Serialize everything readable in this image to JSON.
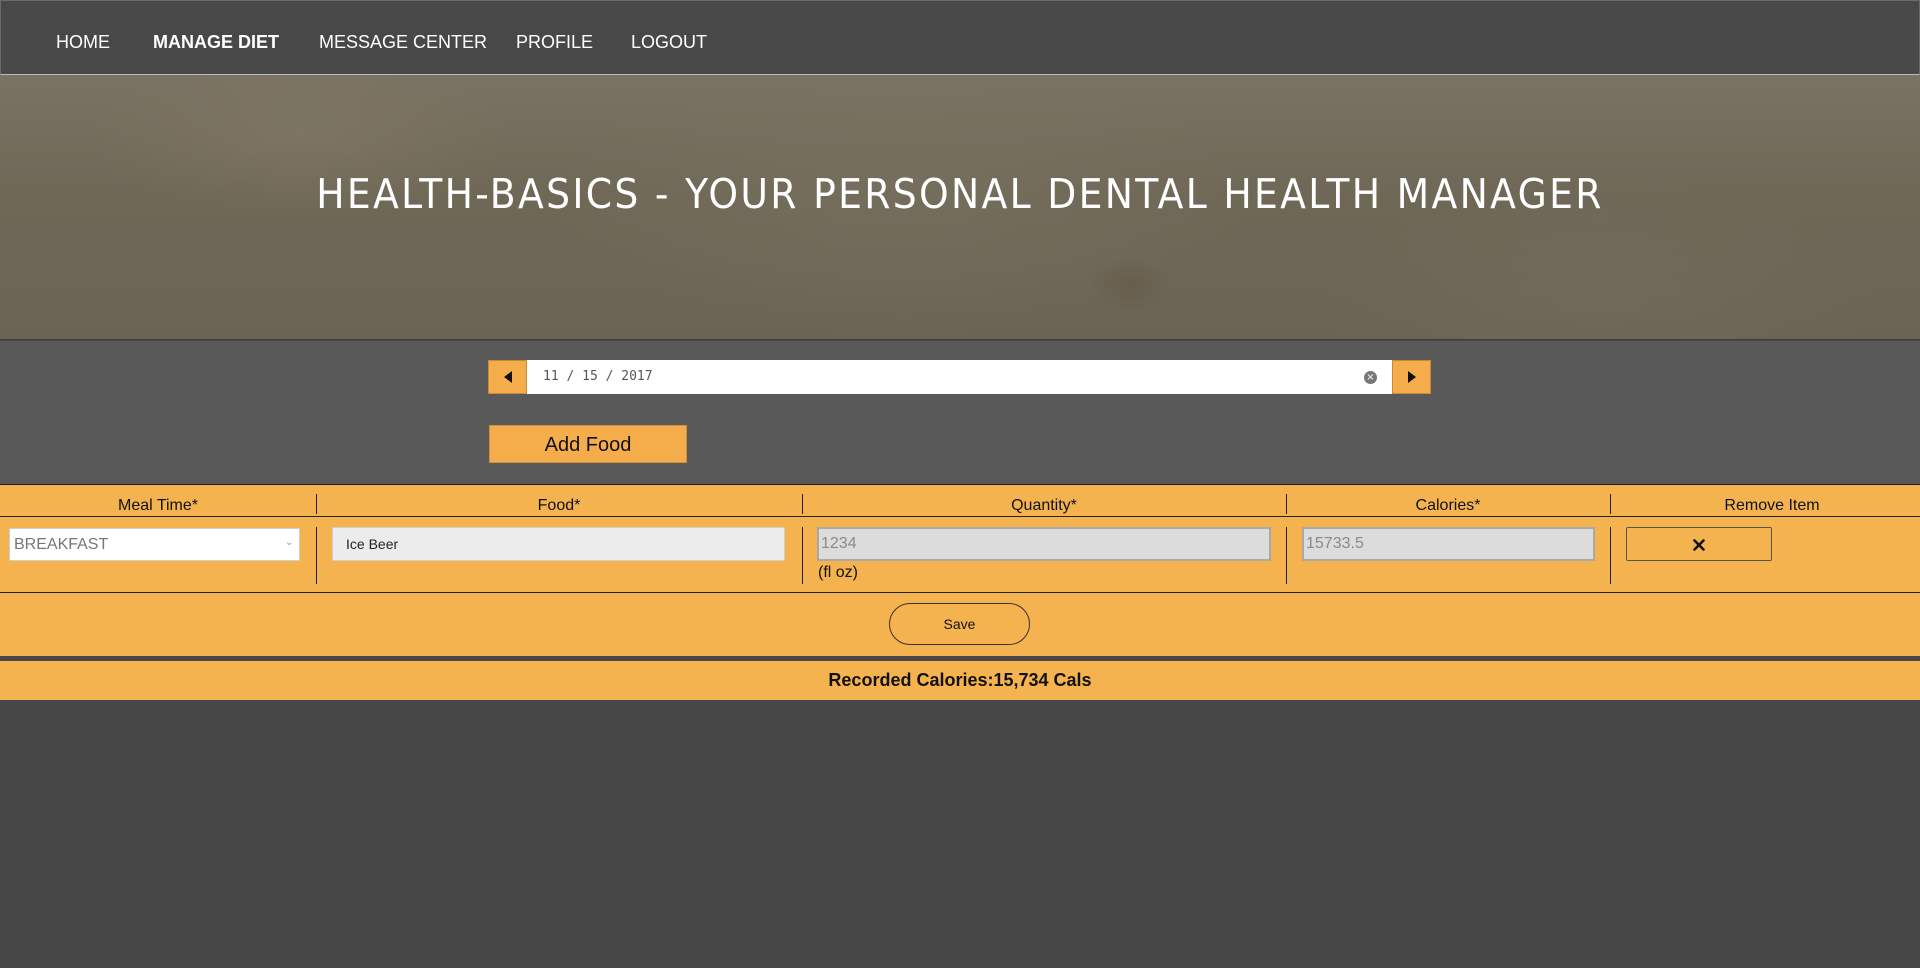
{
  "nav": {
    "items": [
      {
        "label": "HOME"
      },
      {
        "label": "MANAGE DIET"
      },
      {
        "label": "MESSAGE CENTER"
      },
      {
        "label": "PROFILE"
      },
      {
        "label": "LOGOUT"
      }
    ],
    "active": "MANAGE DIET"
  },
  "hero": {
    "title": "HEALTH-BASICS - YOUR PERSONAL DENTAL HEALTH MANAGER"
  },
  "date_picker": {
    "value": "11 / 15 / 2017",
    "prev_icon": "caret-left-icon",
    "next_icon": "caret-right-icon",
    "clear_icon": "clear-circle-icon"
  },
  "add_food_label": "Add Food",
  "table": {
    "headers": {
      "meal_time": "Meal Time*",
      "food": "Food*",
      "quantity": "Quantity*",
      "calories": "Calories*",
      "remove": "Remove Item"
    },
    "rows": [
      {
        "meal_time": "BREAKFAST",
        "food": "Ice Beer",
        "quantity": "1234",
        "unit": "(fl oz)",
        "calories": "15733.5",
        "remove_icon": "close-x-icon"
      }
    ]
  },
  "save_label": "Save",
  "summary": "Recorded Calories:15,734 Cals",
  "colors": {
    "accent": "#f5b350",
    "nav_bg": "#484848",
    "page_bg": "#474747",
    "controls_bg": "#595959"
  }
}
